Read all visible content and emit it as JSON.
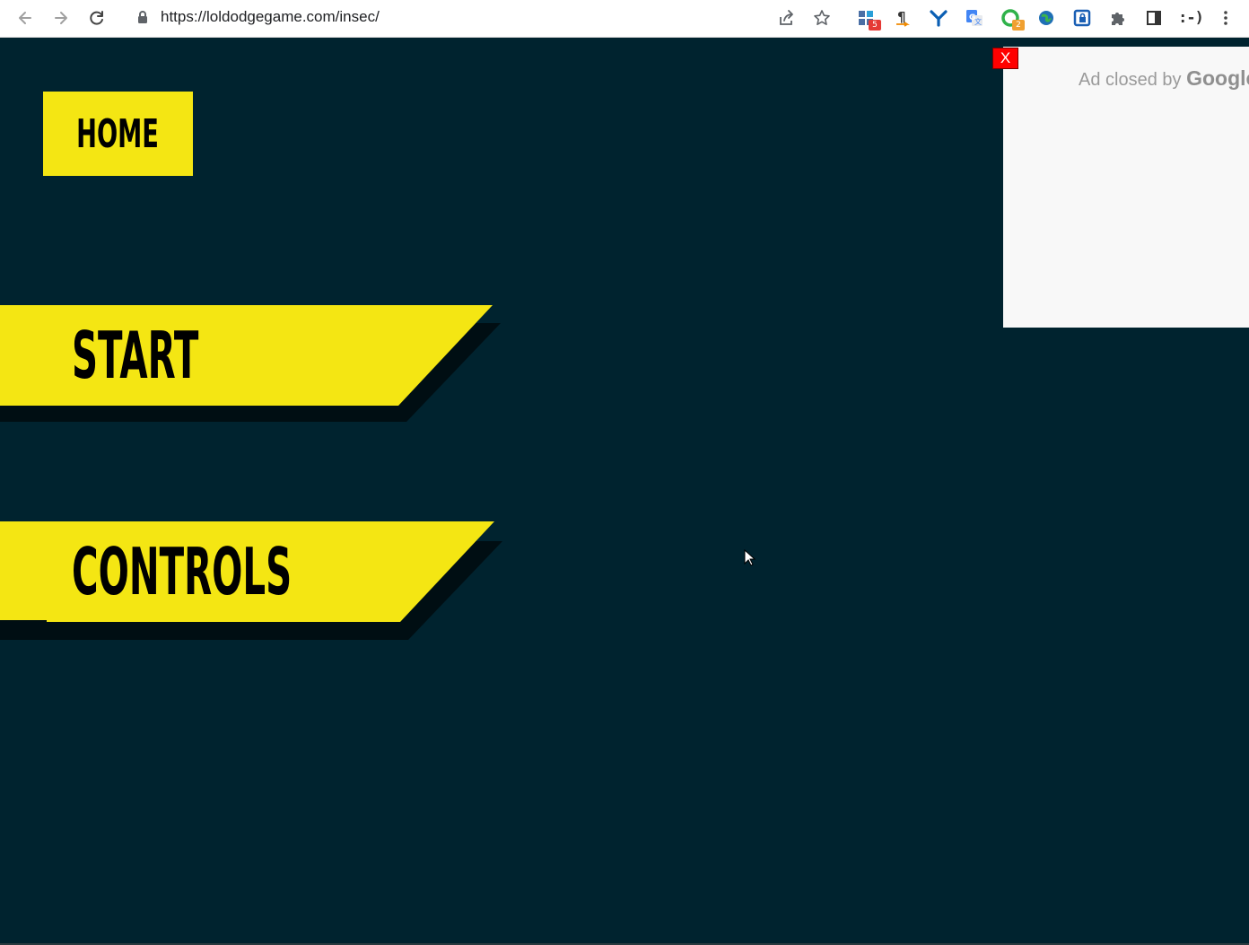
{
  "browser": {
    "url": "https://loldodgegame.com/insec/",
    "icons": {
      "back": "back-arrow-icon",
      "forward": "forward-arrow-icon",
      "reload": "reload-icon",
      "lock": "lock-icon",
      "share": "share-icon",
      "bookmark": "star-icon"
    },
    "extensions": [
      {
        "name": "extension-grid-icon",
        "badge": "5",
        "badge_color": "#e53935"
      },
      {
        "name": "paragraph-extension-icon",
        "badge": ""
      },
      {
        "name": "y-extension-icon",
        "badge": ""
      },
      {
        "name": "translate-extension-icon",
        "badge": ""
      },
      {
        "name": "green-circle-extension-icon",
        "badge": "2",
        "badge_color": "#f0a030"
      },
      {
        "name": "globe-extension-icon",
        "badge": ""
      },
      {
        "name": "lock-badge-extension-icon",
        "badge": ""
      },
      {
        "name": "puzzle-icon",
        "badge": ""
      },
      {
        "name": "side-panel-icon",
        "badge": ""
      }
    ],
    "smiley_text": ":-)",
    "menu_icon": "kebab-menu-icon"
  },
  "game": {
    "background_color": "#00232f",
    "accent_color": "#f4e613",
    "home_label": "HOME",
    "start_label": "START",
    "controls_label": "CONTROLS"
  },
  "ad": {
    "close_label": "X",
    "closed_prefix": "Ad closed by ",
    "closed_brand": "Google"
  }
}
